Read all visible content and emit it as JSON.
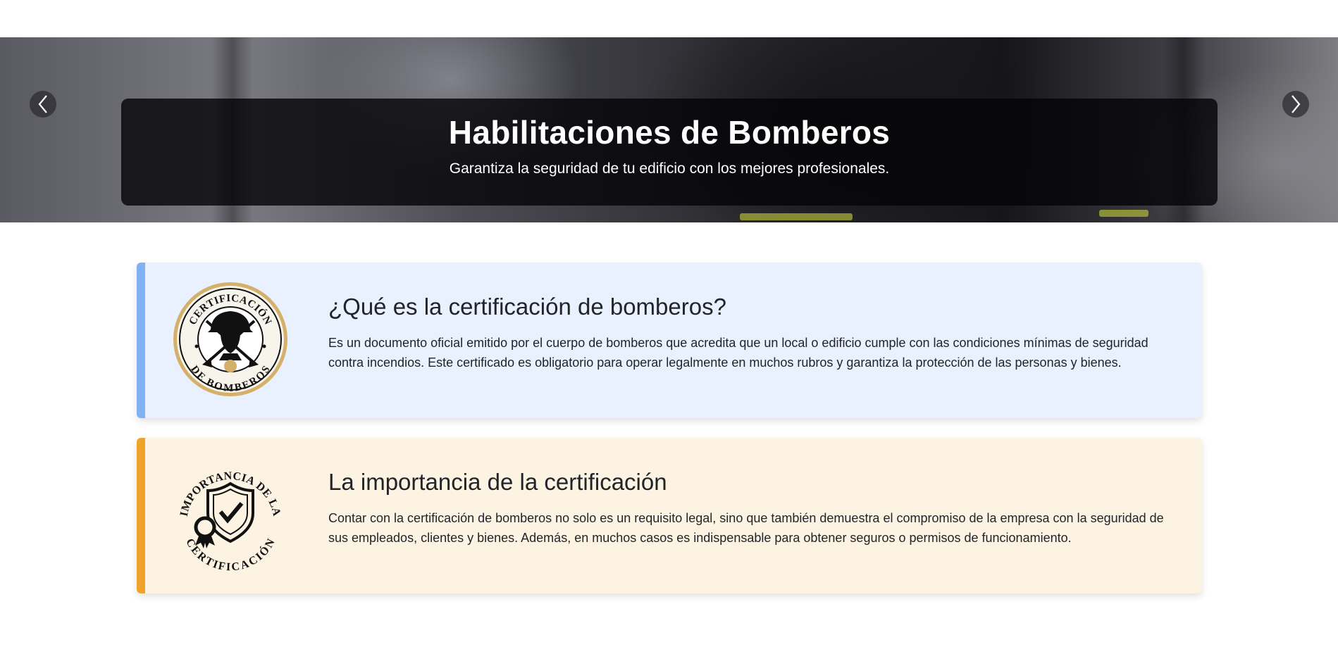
{
  "hero": {
    "title": "Habilitaciones de Bomberos",
    "subtitle": "Garantiza la seguridad de tu edificio con los mejores profesionales.",
    "prev_icon": "chevron-left-icon",
    "next_icon": "chevron-right-icon"
  },
  "cards": [
    {
      "title": "¿Qué es la certificación de bomberos?",
      "text": "Es un documento oficial emitido por el cuerpo de bomberos que acredita que un local o edificio cumple con las condiciones mínimas de seguridad contra incendios. Este certificado es obligatorio para operar legalmente en muchos rubros y garantiza la protección de las personas y bienes.",
      "icon": "firefighter-badge-icon",
      "badge_top": "CERTIFICACIÓN",
      "badge_bottom": "DE BOMBEROS",
      "accent": "#7fb1f3",
      "background": "#e8f1fd"
    },
    {
      "title": "La importancia de la certificación",
      "text": "Contar con la certificación de bomberos no solo es un requisito legal, sino que también demuestra el compromiso de la empresa con la seguridad de sus empleados, clientes y bienes. Además, en muchos casos es indispensable para obtener seguros o permisos de funcionamiento.",
      "icon": "shield-check-icon",
      "badge_top": "IMPORTANCIA DE LA",
      "badge_bottom": "CERTIFICACIÓN",
      "accent": "#f0a32a",
      "background": "#fdf3e3"
    }
  ]
}
